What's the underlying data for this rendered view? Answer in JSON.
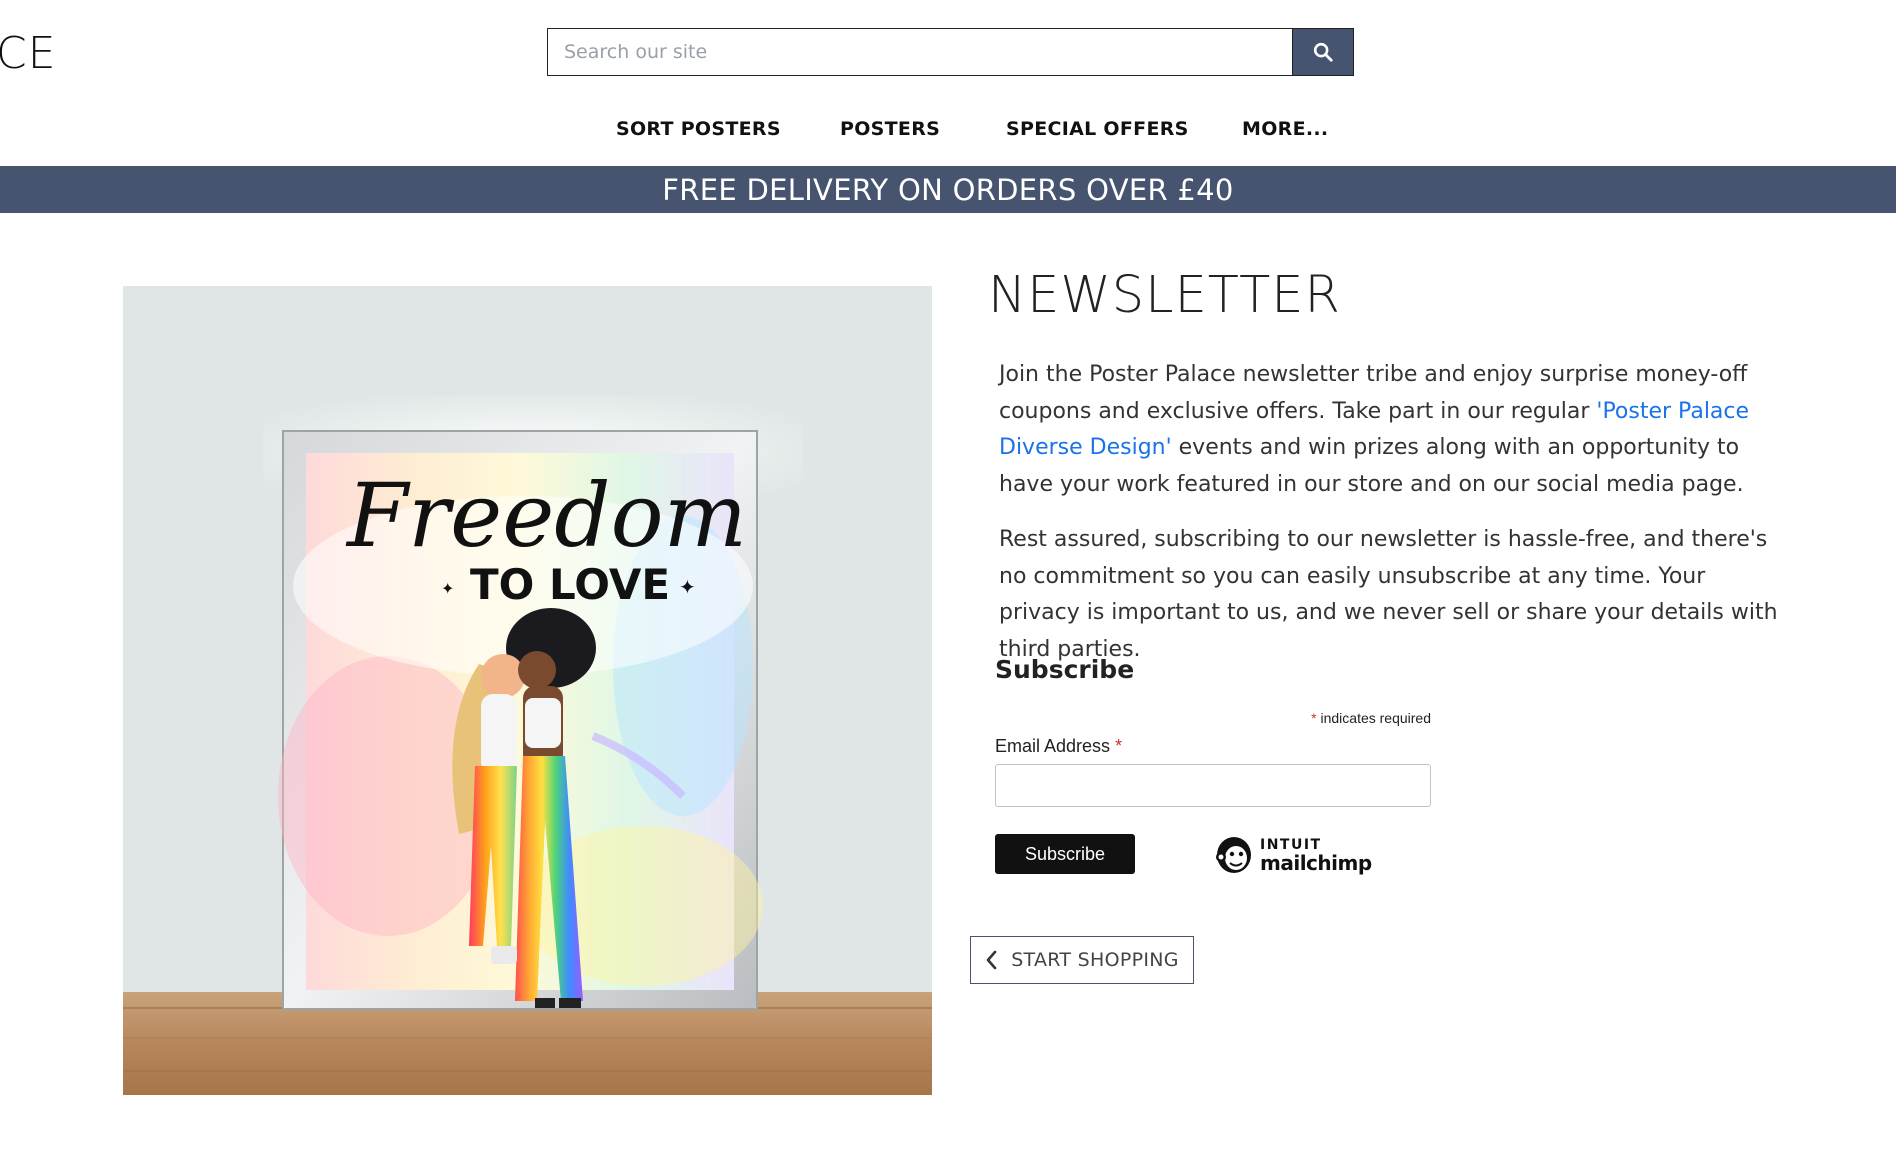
{
  "header": {
    "logo_fragment": "CE",
    "search": {
      "placeholder": "Search our site",
      "value": ""
    },
    "search_icon": "search-icon"
  },
  "nav": {
    "items": [
      {
        "label": "SORT POSTERS"
      },
      {
        "label": "POSTERS"
      },
      {
        "label": "SPECIAL OFFERS"
      },
      {
        "label": "MORE..."
      }
    ]
  },
  "banner": {
    "text": "FREE DELIVERY ON ORDERS OVER £40"
  },
  "hero": {
    "poster_script": "Freedom",
    "poster_tagline": "TO LOVE"
  },
  "newsletter": {
    "title": "NEWSLETTER",
    "para1_before": "Join the Poster Palace newsletter tribe and enjoy surprise money-off coupons and exclusive offers. Take part in our regular ",
    "para1_link": "'Poster Palace Diverse Design'",
    "para1_after": " events and win prizes along with an opportunity to have your work featured in our store and on our social media page.",
    "para2": "Rest assured, subscribing to our newsletter is hassle-free, and there's no commitment so you can easily unsubscribe at any time. Your privacy is important to us, and we never sell or share your details with third parties."
  },
  "form": {
    "heading": "Subscribe",
    "required_asterisk": "*",
    "required_note": " indicates required",
    "email_label": "Email Address ",
    "email_value": "",
    "subscribe_label": "Subscribe",
    "mailchimp_intuit": "INTUIT",
    "mailchimp_name": "mailchimp"
  },
  "start_shopping": {
    "label": "START SHOPPING",
    "icon": "chevron-left-icon"
  },
  "colors": {
    "accent": "#465470",
    "link": "#1a73e8",
    "required": "#c0392b",
    "button_dark": "#111111"
  }
}
